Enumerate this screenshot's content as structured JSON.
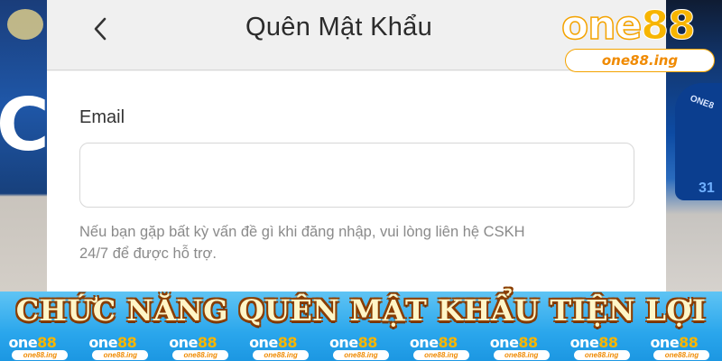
{
  "header": {
    "back_icon": "chevron-left-icon",
    "title": "Quên Mật Khẩu"
  },
  "form": {
    "email_label": "Email",
    "email_value": "",
    "email_placeholder": "",
    "hint_line1": "Nếu bạn gặp bất kỳ vấn đề gì khi đăng nhập, vui lòng liên hệ CSKH",
    "hint_line2": "24/7 để được hỗ trợ."
  },
  "logo": {
    "one": "one",
    "num": "88",
    "domain": "one88.ing"
  },
  "banner": {
    "title": "CHỨC NĂNG QUÊN MẬT KHẨU TIỆN LỢI",
    "watermark_one": "one",
    "watermark_num": "88",
    "watermark_domain": "one88.ing",
    "watermark_count": 9
  },
  "background": {
    "left_letter": "C",
    "right_jersey_text": "ONE8",
    "right_number": "31"
  },
  "colors": {
    "brand_orange": "#f7b500",
    "banner_blue": "#2aa6ec",
    "title_text": "#2b2b2b",
    "hint_text": "#8a8a8a"
  }
}
